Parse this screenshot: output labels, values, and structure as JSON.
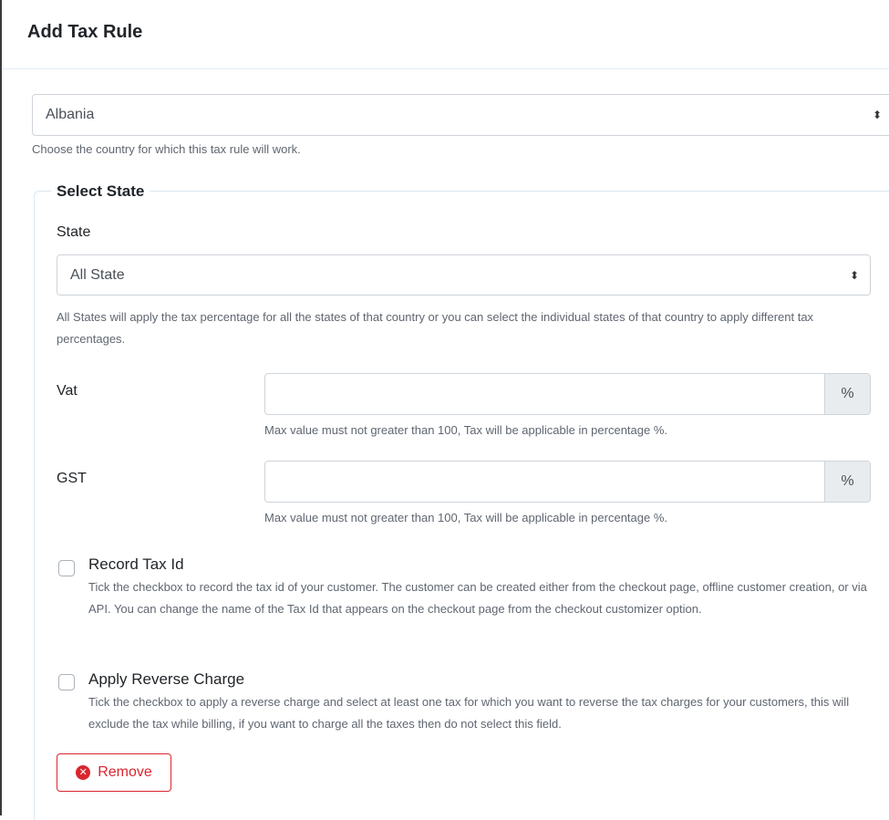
{
  "header": {
    "title": "Add Tax Rule"
  },
  "country": {
    "selected": "Albania",
    "help": "Choose the country for which this tax rule will work."
  },
  "state_section": {
    "legend": "Select State",
    "label": "State",
    "selected": "All State",
    "help": "All States will apply the tax percentage for all the states of that country or you can select the individual states of that country to apply different tax percentages."
  },
  "taxes": [
    {
      "label": "Vat",
      "value": "",
      "addon": "%",
      "help": "Max value must not greater than 100, Tax will be applicable in percentage %."
    },
    {
      "label": "GST",
      "value": "",
      "addon": "%",
      "help": "Max value must not greater than 100, Tax will be applicable in percentage %."
    }
  ],
  "record_tax_id": {
    "label": "Record Tax Id",
    "checked": false,
    "help": "Tick the checkbox to record the tax id of your customer. The customer can be created either from the checkout page, offline customer creation, or via API. You can change the name of the Tax Id that appears on the checkout page from the checkout customizer option."
  },
  "reverse_charge": {
    "label": "Apply Reverse Charge",
    "checked": false,
    "help": "Tick the checkbox to apply a reverse charge and select at least one tax for which you want to reverse the tax charges for your customers, this will exclude the tax while billing, if you want to charge all the taxes then do not select this field."
  },
  "remove_button": {
    "label": "Remove",
    "icon": "times-circle-icon"
  },
  "colors": {
    "danger": "#d9262f",
    "border": "#ced4da",
    "addon_bg": "#e9ecef"
  }
}
